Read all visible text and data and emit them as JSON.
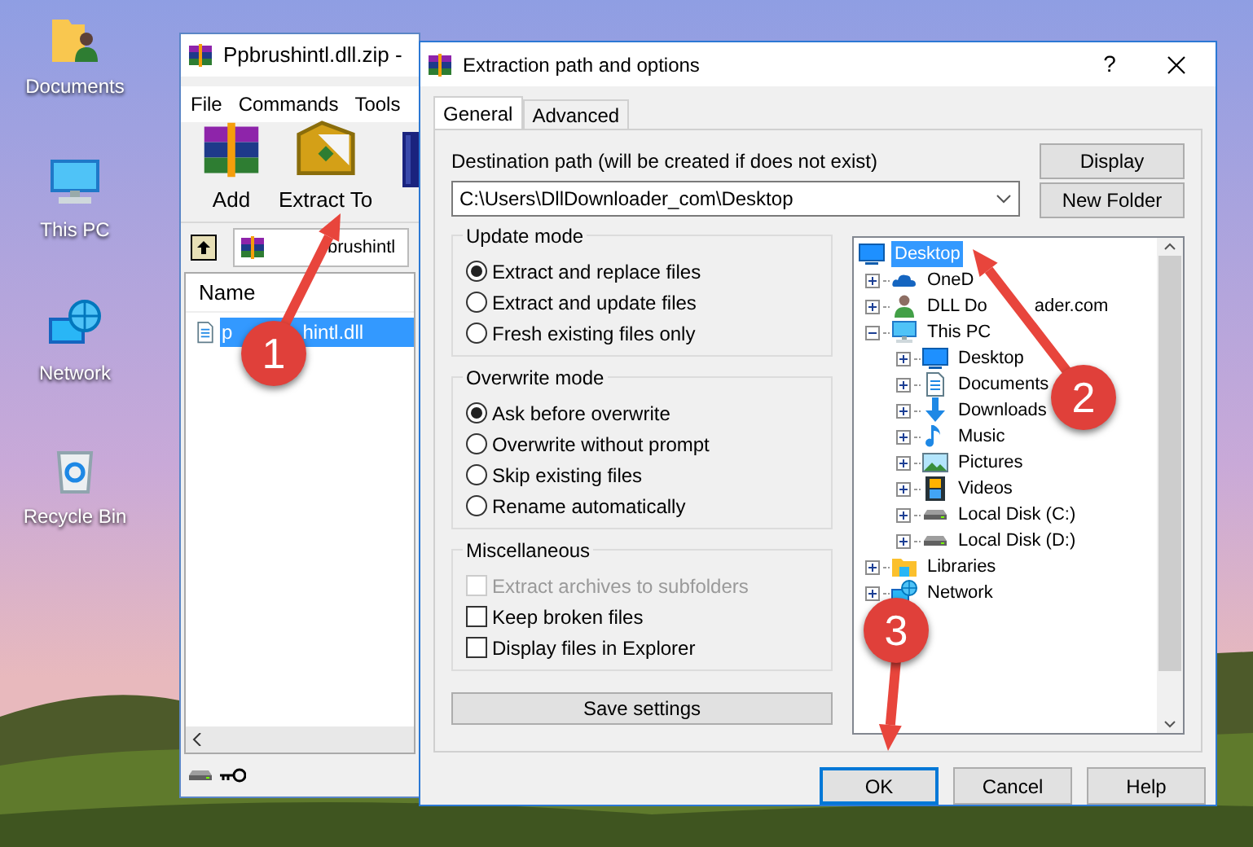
{
  "desktop_icons": [
    {
      "label": "Documents",
      "kind": "user-folder"
    },
    {
      "label": "This PC",
      "kind": "monitor"
    },
    {
      "label": "Network",
      "kind": "globe"
    },
    {
      "label": "Recycle Bin",
      "kind": "bin"
    }
  ],
  "archiver_window": {
    "title": "Ppbrushintl.dll.zip -",
    "menu": [
      "File",
      "Commands",
      "Tools"
    ],
    "toolbar": [
      {
        "label": "Add",
        "kind": "books"
      },
      {
        "label": "Extract To",
        "kind": "extract"
      }
    ],
    "path": "brushintl",
    "column": "Name",
    "files": [
      {
        "name": "p",
        "name_rest": "hintl.dll",
        "selected": true
      }
    ]
  },
  "dialog": {
    "title": "Extraction path and options",
    "help": "?",
    "tabs": [
      {
        "label": "General",
        "selected": true
      },
      {
        "label": "Advanced",
        "selected": false
      }
    ],
    "destination_label": "Destination path (will be created if does not exist)",
    "destination_path": "C:\\Users\\DllDownloader_com\\Desktop",
    "side_buttons": [
      "Display",
      "New Folder"
    ],
    "update_mode": {
      "title": "Update mode",
      "options": [
        {
          "label": "Extract and replace files",
          "selected": true
        },
        {
          "label": "Extract and update files",
          "selected": false
        },
        {
          "label": "Fresh existing files only",
          "selected": false
        }
      ]
    },
    "overwrite_mode": {
      "title": "Overwrite mode",
      "options": [
        {
          "label": "Ask before overwrite",
          "selected": true
        },
        {
          "label": "Overwrite without prompt",
          "selected": false
        },
        {
          "label": "Skip existing files",
          "selected": false
        },
        {
          "label": "Rename automatically",
          "selected": false
        }
      ]
    },
    "miscellaneous": {
      "title": "Miscellaneous",
      "options": [
        {
          "label": "Extract archives to subfolders",
          "checked": false,
          "disabled": true
        },
        {
          "label": "Keep broken files",
          "checked": false,
          "disabled": false
        },
        {
          "label": "Display files in Explorer",
          "checked": false,
          "disabled": false
        }
      ]
    },
    "save_button": "Save settings",
    "tree": [
      {
        "label": "Desktop",
        "kind": "screen",
        "selected": true,
        "children": [
          {
            "label": "OneD",
            "kind": "cloud",
            "selected": false,
            "expanded": false
          },
          {
            "label": "DLL Do",
            "label_rest": "ader.com",
            "kind": "user",
            "selected": false,
            "expanded": false
          },
          {
            "label": "This PC",
            "kind": "monitor",
            "selected": false,
            "expanded": true,
            "children": [
              {
                "label": "Desktop",
                "kind": "screen",
                "selected": false,
                "expanded": false
              },
              {
                "label": "Documents",
                "kind": "document",
                "selected": false,
                "expanded": false
              },
              {
                "label": "Downloads",
                "kind": "download",
                "selected": false,
                "expanded": false
              },
              {
                "label": "Music",
                "kind": "music",
                "selected": false,
                "expanded": false
              },
              {
                "label": "Pictures",
                "kind": "picture",
                "selected": false,
                "expanded": false
              },
              {
                "label": "Videos",
                "kind": "video",
                "selected": false,
                "expanded": false
              },
              {
                "label": "Local Disk (C:)",
                "kind": "drive",
                "selected": false,
                "expanded": false
              },
              {
                "label": "Local Disk (D:)",
                "kind": "drive",
                "selected": false,
                "expanded": false
              }
            ]
          },
          {
            "label": "Libraries",
            "kind": "folder",
            "selected": false,
            "expanded": false
          },
          {
            "label": "Network",
            "kind": "globe",
            "selected": false,
            "expanded": false
          }
        ]
      }
    ],
    "buttons": [
      {
        "label": "OK",
        "default": true
      },
      {
        "label": "Cancel",
        "default": false
      },
      {
        "label": "Help",
        "default": false
      }
    ]
  },
  "annotations": [
    {
      "number": "1"
    },
    {
      "number": "2"
    },
    {
      "number": "3"
    }
  ]
}
